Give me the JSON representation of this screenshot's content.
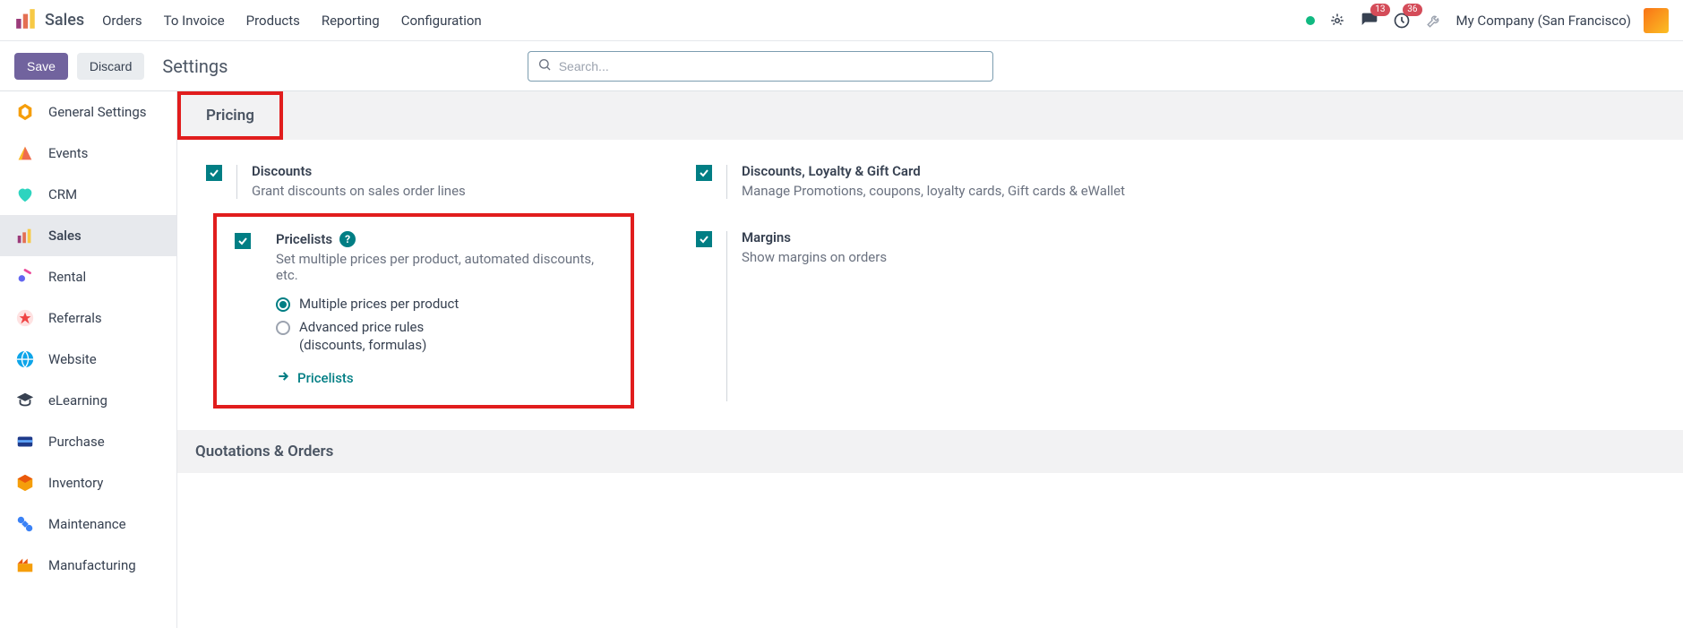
{
  "brand": {
    "name": "Sales"
  },
  "nav": {
    "items": [
      {
        "label": "Orders"
      },
      {
        "label": "To Invoice"
      },
      {
        "label": "Products"
      },
      {
        "label": "Reporting"
      },
      {
        "label": "Configuration"
      }
    ]
  },
  "systray": {
    "messages_badge": "13",
    "activities_badge": "36",
    "company": "My Company (San Francisco)"
  },
  "control": {
    "save": "Save",
    "discard": "Discard",
    "title": "Settings",
    "search_placeholder": "Search..."
  },
  "sidebar": {
    "items": [
      {
        "label": "General Settings"
      },
      {
        "label": "Events"
      },
      {
        "label": "CRM"
      },
      {
        "label": "Sales"
      },
      {
        "label": "Rental"
      },
      {
        "label": "Referrals"
      },
      {
        "label": "Website"
      },
      {
        "label": "eLearning"
      },
      {
        "label": "Purchase"
      },
      {
        "label": "Inventory"
      },
      {
        "label": "Maintenance"
      },
      {
        "label": "Manufacturing"
      }
    ]
  },
  "sections": {
    "pricing": {
      "title": "Pricing",
      "discounts": {
        "title": "Discounts",
        "desc": "Grant discounts on sales order lines"
      },
      "loyalty": {
        "title": "Discounts, Loyalty & Gift Card",
        "desc": "Manage Promotions, coupons, loyalty cards, Gift cards & eWallet"
      },
      "pricelists": {
        "title": "Pricelists",
        "desc": "Set multiple prices per product, automated discounts, etc.",
        "radio1": "Multiple prices per product",
        "radio2": "Advanced price rules",
        "radio2_sub": "(discounts, formulas)",
        "link": "Pricelists"
      },
      "margins": {
        "title": "Margins",
        "desc": "Show margins on orders"
      }
    },
    "quotations": {
      "title": "Quotations & Orders"
    }
  }
}
